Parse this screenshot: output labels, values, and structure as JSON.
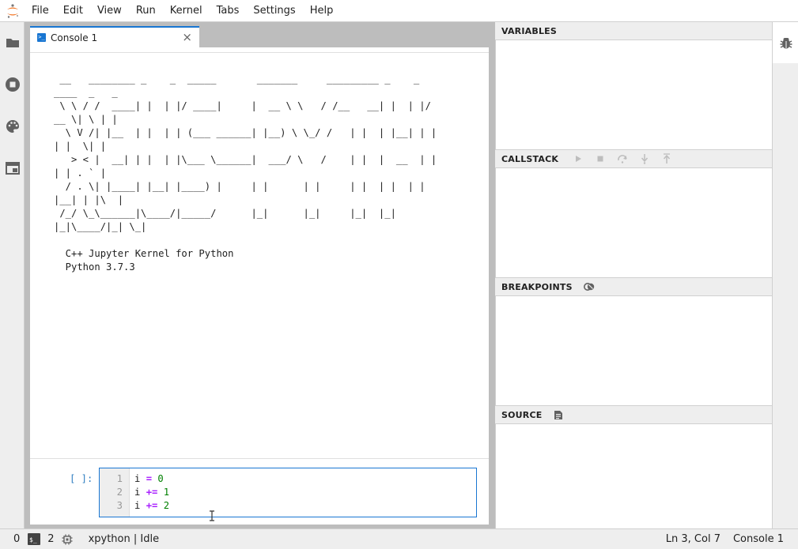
{
  "menubar": {
    "items": [
      "File",
      "Edit",
      "View",
      "Run",
      "Kernel",
      "Tabs",
      "Settings",
      "Help"
    ]
  },
  "left_sidebar": {
    "icons": [
      "folder-icon",
      "running-sessions-icon",
      "palette-icon",
      "tabs-icon"
    ]
  },
  "tabs": [
    {
      "label": "Console 1",
      "icon": "console-icon",
      "close": "×"
    }
  ],
  "console": {
    "banner_lines": [
      " __   ________ _    _  _____       _______     _________ _    _",
      "____  _   _",
      " \\ \\ / /  ____| |  | |/ ____|     |  __ \\ \\   / /__   __| |  | |/",
      "__ \\| \\ | |",
      "  \\ V /| |__  | |  | | (___ ______| |__) \\ \\_/ /   | |  | |__| | |",
      "| |  \\| |",
      "   > < |  __| | |  | |\\___ \\______|  ___/ \\   /    | |  |  __  | |",
      "| | . ` |",
      "  / . \\| |____| |__| |____) |     | |      | |     | |  | |  | |",
      "|__| | |\\  |",
      " /_/ \\_\\______|\\____/|_____/      |_|      |_|     |_|  |_|",
      "|_|\\____/|_| \\_|",
      "",
      "  C++ Jupyter Kernel for Python",
      "  Python 3.7.3"
    ],
    "prompt": "[ ]:",
    "code": {
      "line_numbers": [
        "1",
        "2",
        "3"
      ],
      "lines": [
        {
          "var": "i",
          "op": "=",
          "num": "0"
        },
        {
          "var": "i",
          "op": "+=",
          "num": "1"
        },
        {
          "var": "i",
          "op": "+=",
          "num": "2"
        }
      ]
    }
  },
  "debugger": {
    "variables_title": "VARIABLES",
    "callstack_title": "CALLSTACK",
    "callstack_icons": [
      "continue-icon",
      "stop-icon",
      "step-over-icon",
      "step-in-icon",
      "step-out-icon"
    ],
    "breakpoints_title": "BREAKPOINTS",
    "breakpoints_icon": "remove-all-breakpoints-icon",
    "source_title": "SOURCE",
    "source_icon": "open-source-icon"
  },
  "right_sidebar": {
    "icons": [
      "debugger-bug-icon"
    ]
  },
  "statusbar": {
    "count_a": "0",
    "count_b": "2",
    "kernel_status": "xpython | Idle",
    "cursor_position": "Ln 3, Col 7",
    "active_doc": "Console 1"
  },
  "colors": {
    "accent": "#1976d2",
    "logo_orange": "#f37726",
    "keyword_purple": "#aa22ff",
    "number_green": "#008000",
    "prompt_blue": "#307fc1"
  }
}
